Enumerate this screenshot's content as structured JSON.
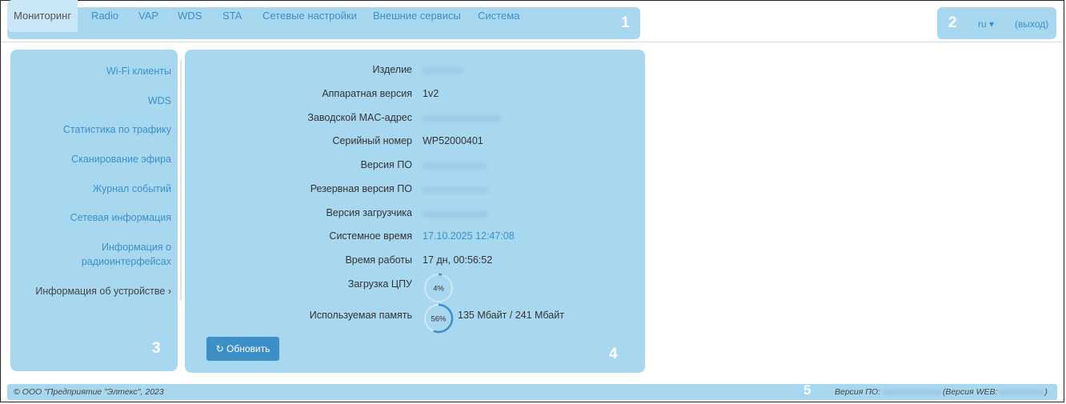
{
  "nav": {
    "tabs": [
      {
        "label": "Мониторинг",
        "active": true
      },
      {
        "label": "Radio"
      },
      {
        "label": "VAP"
      },
      {
        "label": "WDS"
      },
      {
        "label": "STA"
      },
      {
        "label": "Сетевые настройки"
      },
      {
        "label": "Внешние сервисы"
      },
      {
        "label": "Система"
      }
    ]
  },
  "callouts": [
    "1",
    "2",
    "3",
    "4",
    "5"
  ],
  "header_right": {
    "lang": "ru ▾",
    "logout": "(выход)"
  },
  "sidebar": {
    "items": [
      {
        "label": "Wi-Fi клиенты"
      },
      {
        "label": "WDS"
      },
      {
        "label": "Статистика по трафику"
      },
      {
        "label": "Сканирование эфира"
      },
      {
        "label": "Журнал событий"
      },
      {
        "label": "Сетевая информация"
      },
      {
        "label_line1": "Информация о",
        "label_line2": "радиоинтерфейсах"
      },
      {
        "label": "Информация об устройстве ›",
        "current": true
      }
    ]
  },
  "device_info": {
    "rows": [
      {
        "label": "Изделие",
        "value": ""
      },
      {
        "label": "Аппаратная версия",
        "value": "1v2"
      },
      {
        "label": "Заводской MAC-адрес",
        "value": ""
      },
      {
        "label": "Серийный номер",
        "value": "WP52000401"
      },
      {
        "label": "Версия ПО",
        "value": ""
      },
      {
        "label": "Резервная версия ПО",
        "value": ""
      },
      {
        "label": "Версия загрузчика",
        "value": ""
      },
      {
        "label": "Системное время",
        "value": "17.10.2025 12:47:08"
      },
      {
        "label": "Время работы",
        "value": "17 дн, 00:56:52"
      },
      {
        "label": "Загрузка ЦПУ",
        "value": ""
      },
      {
        "label": "Используемая память",
        "value": ""
      }
    ],
    "cpu_load_percent": 4,
    "cpu_load_text": "4%",
    "memory_percent": 56,
    "memory_percent_text": "56%",
    "memory_text": "135 Мбайт / 241 Мбайт"
  },
  "refresh_button": {
    "icon": "refresh-icon",
    "label": "Обновить"
  },
  "footer": {
    "copyright": "© ООО \"Предприятие \"Элтекс\", 2023",
    "fw_prefix": "Версия ПО:",
    "web_prefix": "(Версия WEB:",
    "web_suffix": ")"
  },
  "colors": {
    "panel": "#a8d8f0",
    "accent": "#3d8fc8",
    "gauge": "#3d8fc8"
  }
}
